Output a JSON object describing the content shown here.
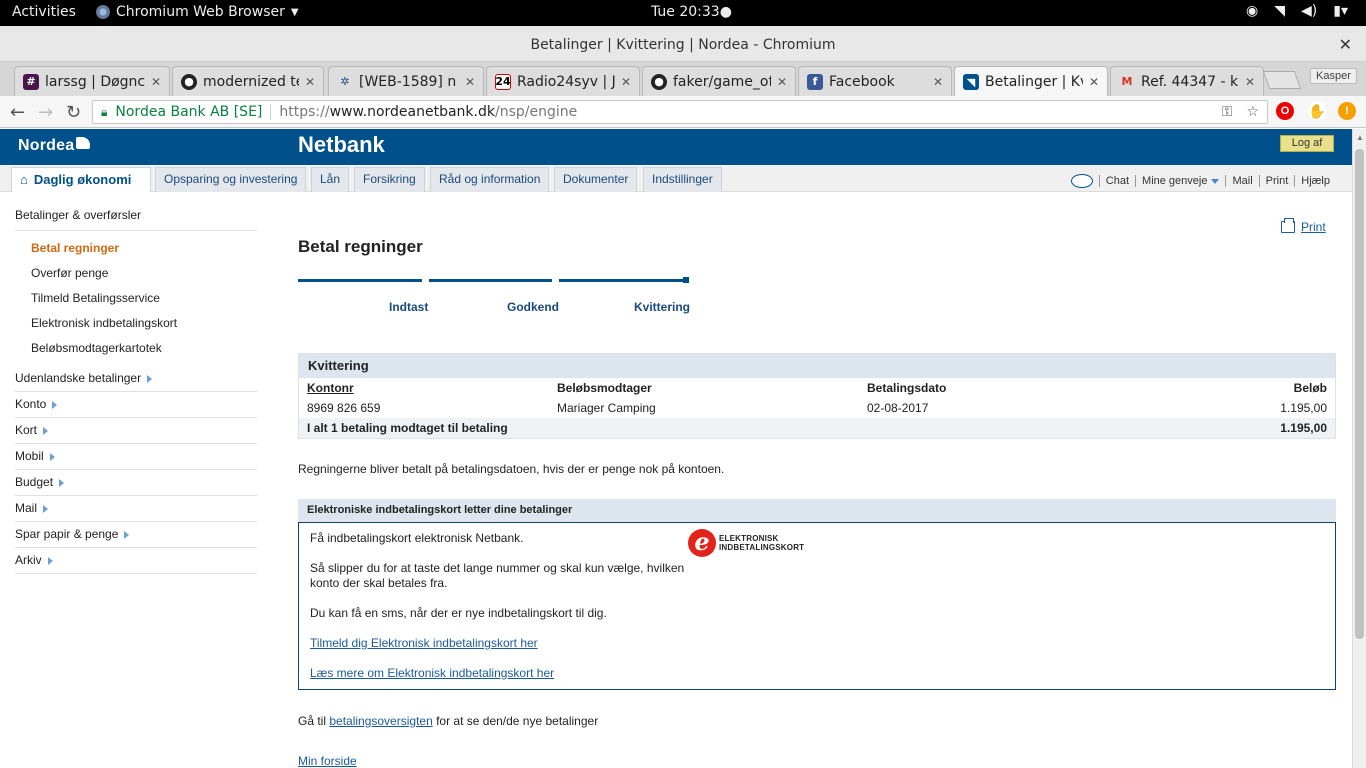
{
  "gnome": {
    "activities": "Activities",
    "app": "Chromium Web Browser",
    "clock": "Tue 20:33"
  },
  "window": {
    "title": "Betalinger | Kvittering | Nordea - Chromium"
  },
  "tabs": [
    {
      "label": "larssg | Døgnc",
      "favicon": "#"
    },
    {
      "label": "modernized te",
      "favicon": "github"
    },
    {
      "label": "[WEB-1589] n",
      "favicon": "jira"
    },
    {
      "label": "Radio24syv | J",
      "favicon": "24"
    },
    {
      "label": "faker/game_of",
      "favicon": "github"
    },
    {
      "label": "Facebook",
      "favicon": "f"
    },
    {
      "label": "Betalinger | Kv",
      "favicon": "nordea"
    },
    {
      "label": "Ref. 44347 - k",
      "favicon": "M"
    }
  ],
  "profile": "Kasper",
  "omnibox": {
    "org": "Nordea Bank AB [SE]",
    "scheme": "https://",
    "host": "www.nordeanetbank.dk",
    "path": "/nsp/engine"
  },
  "header": {
    "logo": "Nordea",
    "title": "Netbank",
    "logout": "Log af"
  },
  "menu": {
    "tabs": [
      "Daglig økonomi",
      "Opsparing og investering",
      "Lån",
      "Forsikring",
      "Råd og information",
      "Dokumenter",
      "Indstillinger"
    ],
    "utility": {
      "chat": "Chat",
      "shortcuts": "Mine genveje",
      "mail": "Mail",
      "print": "Print",
      "help": "Hjælp"
    }
  },
  "sidebar": {
    "heading": "Betalinger & overførsler",
    "subitems": [
      "Betal regninger",
      "Overfør penge",
      "Tilmeld Betalingsservice",
      "Elektronisk indbetalingskort",
      "Beløbsmodtagerkartotek"
    ],
    "groups": [
      "Udenlandske betalinger",
      "Konto",
      "Kort",
      "Mobil",
      "Budget",
      "Mail",
      "Spar papir & penge",
      "Arkiv"
    ]
  },
  "main": {
    "title": "Betal regninger",
    "print": "Print",
    "steps": [
      "Indtast",
      "Godkend",
      "Kvittering"
    ],
    "receipt": {
      "title": "Kvittering",
      "columns": [
        "Kontonr",
        "Beløbsmodtager",
        "Betalingsdato",
        "Beløb"
      ],
      "rows": [
        [
          "8969 826 659",
          "Mariager Camping",
          "02-08-2017",
          "1.195,00"
        ]
      ],
      "total_label": "I alt 1 betaling modtaget til betaling",
      "total_value": "1.195,00"
    },
    "note": "Regningerne bliver betalt på betalingsdatoen, hvis der er penge nok på kontoen.",
    "ecard": {
      "title": "Elektroniske indbetalingskort letter dine betalinger",
      "p1": "Få indbetalingskort elektronisk  Netbank.",
      "p2": "Så slipper du for at taste det lange nummer og skal kun vælge, hvilken konto der skal betales fra.",
      "p3": "Du kan få en sms, når der er nye indbetalingskort til dig.",
      "link1": "Tilmeld dig Elektronisk indbetalingskort her",
      "link2": "Læs mere om Elektronisk indbetalingskort her",
      "logo_line1": "ELEKTRONISK",
      "logo_line2": "INDBETALINGSKORT"
    },
    "goto_prefix": "Gå til ",
    "goto_link": "betalingsoversigten",
    "goto_suffix": " for at se den/de nye betalinger",
    "home_link": "Min forside"
  }
}
